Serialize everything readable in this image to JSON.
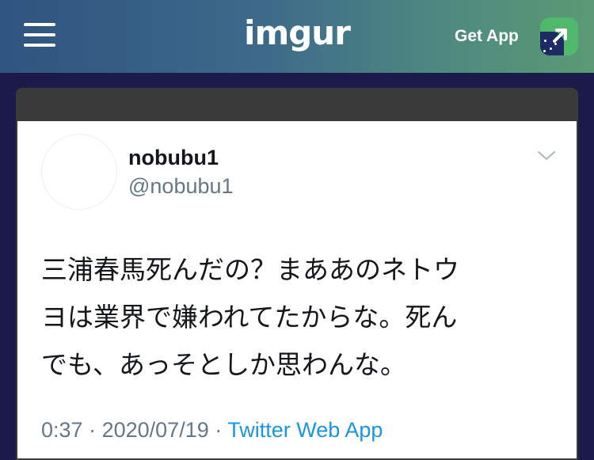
{
  "header": {
    "logo": "imgur",
    "get_app_label": "Get App",
    "colors": {
      "gradient_start": "#2f5480",
      "gradient_end": "#5a9a74",
      "app_icon": "#4fb86a"
    }
  },
  "tweet": {
    "display_name": "nobubu1",
    "handle": "@nobubu1",
    "text_lines": [
      "三浦春馬死んだの？まああのネトウ",
      "ヨは業界で嫌われてたからな。死ん",
      "でも、あっそとしか思わんな。"
    ],
    "time": "0:37",
    "separator": "·",
    "date": "2020/07/19",
    "source": "Twitter Web App",
    "colors": {
      "text": "#14171a",
      "muted": "#657786",
      "link": "#1b95e0"
    }
  }
}
